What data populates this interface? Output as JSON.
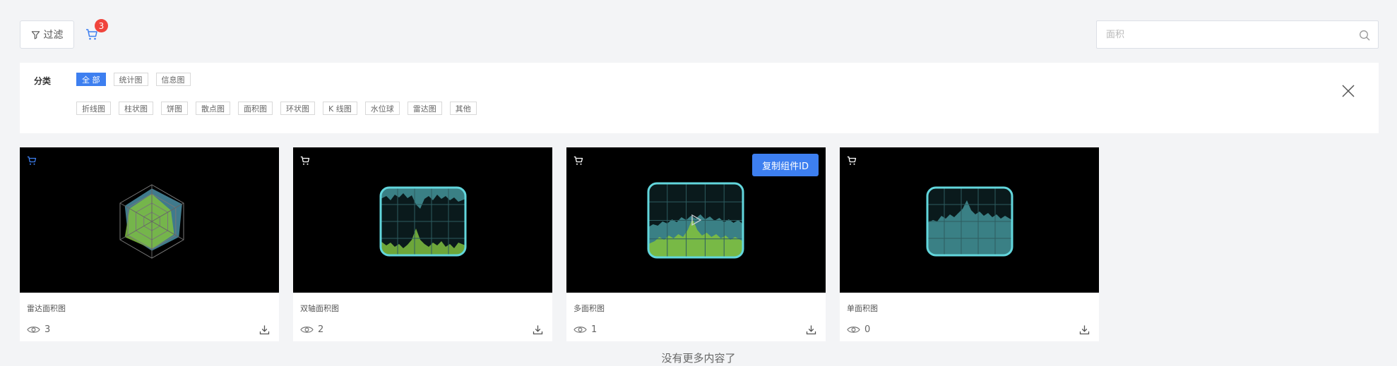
{
  "toolbar": {
    "filter_label": "过滤",
    "cart_count": "3"
  },
  "search": {
    "placeholder": "面积"
  },
  "filter": {
    "category_label": "分类",
    "row1": [
      "全 部",
      "统计图",
      "信息图"
    ],
    "row2": [
      "折线图",
      "柱状图",
      "饼图",
      "散点图",
      "面积图",
      "环状图",
      "K 线图",
      "水位球",
      "雷达图",
      "其他"
    ],
    "active": "全 部"
  },
  "cards": [
    {
      "title": "雷达面积图",
      "views": "3",
      "art": "radar"
    },
    {
      "title": "双轴面积图",
      "views": "2",
      "art": "dual"
    },
    {
      "title": "多面积图",
      "views": "1",
      "art": "multi",
      "copy_label": "复制组件ID"
    },
    {
      "title": "单面积图",
      "views": "0",
      "art": "single"
    }
  ],
  "footer": {
    "no_more": "没有更多内容了"
  },
  "colors": {
    "accent": "#3d7ff0",
    "badge": "#f0443c",
    "teal": "#62d6dc",
    "green": "#7fbf3f"
  }
}
